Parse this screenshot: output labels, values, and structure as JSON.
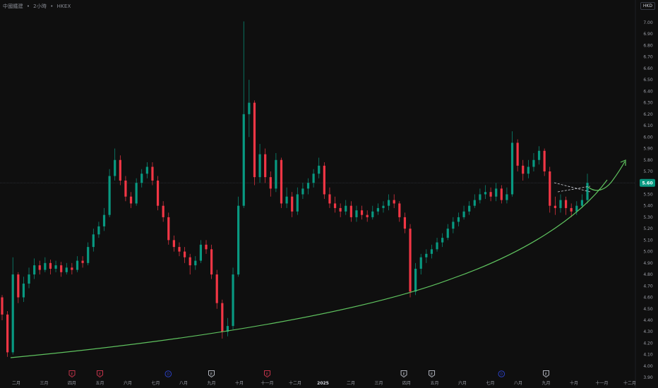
{
  "header": {
    "symbol": "中國鐵建",
    "interval": "2小時",
    "exchange": "HKEX",
    "currency": "HKD"
  },
  "colors": {
    "up": "#089981",
    "down": "#f23645",
    "trendline": "#5fc35f",
    "price_label": "#089981",
    "background": "#0f0f0f",
    "event_earnings": "#c2334a",
    "event_earnings_neutral": "#b2b5be",
    "event_dividend": "#2a3fbf"
  },
  "chart_data": {
    "type": "candlestick",
    "title": "",
    "ylim": [
      3.9,
      7.1
    ],
    "y_ticks": [
      "7.00",
      "6.90",
      "6.80",
      "6.70",
      "6.60",
      "6.50",
      "6.40",
      "6.30",
      "6.20",
      "6.10",
      "6.00",
      "5.90",
      "5.80",
      "5.70",
      "5.60",
      "5.50",
      "5.40",
      "5.30",
      "5.20",
      "5.10",
      "5.00",
      "4.90",
      "4.80",
      "4.70",
      "4.60",
      "4.50",
      "4.40",
      "4.30",
      "4.20",
      "4.10",
      "4.00",
      "3.90"
    ],
    "x_ticks": [
      "二月",
      "三月",
      "四月",
      "五月",
      "六月",
      "七月",
      "八月",
      "九月",
      "十月",
      "十一月",
      "十二月",
      "2025",
      "二月",
      "三月",
      "四月",
      "五月",
      "六月",
      "七月",
      "八月",
      "九月",
      "十月",
      "十一月",
      "十二月"
    ],
    "current_price": "5.60",
    "first_open": 4.6,
    "close": [
      4.45,
      4.12,
      4.8,
      4.6,
      4.72,
      4.8,
      4.88,
      4.84,
      4.9,
      4.85,
      4.88,
      4.82,
      4.86,
      4.84,
      4.92,
      4.9,
      5.04,
      5.15,
      5.22,
      5.32,
      5.66,
      5.8,
      5.62,
      5.48,
      5.42,
      5.6,
      5.68,
      5.74,
      5.62,
      5.4,
      5.3,
      5.1,
      5.04,
      5.0,
      4.95,
      4.88,
      4.92,
      5.06,
      5.02,
      4.8,
      4.55,
      4.3,
      4.35,
      4.8,
      5.4,
      6.2,
      6.3,
      5.65,
      5.85,
      5.65,
      5.55,
      5.8,
      5.42,
      5.48,
      5.35,
      5.5,
      5.55,
      5.6,
      5.68,
      5.75,
      5.5,
      5.42,
      5.38,
      5.35,
      5.4,
      5.3,
      5.36,
      5.32,
      5.3,
      5.35,
      5.38,
      5.4,
      5.45,
      5.42,
      5.3,
      5.2,
      4.65,
      4.85,
      4.95,
      4.98,
      5.02,
      5.08,
      5.12,
      5.2,
      5.26,
      5.3,
      5.35,
      5.4,
      5.45,
      5.5,
      5.52,
      5.48,
      5.55,
      5.45,
      5.5,
      5.95,
      5.75,
      5.68,
      5.74,
      5.8,
      5.88,
      5.7,
      5.4,
      5.38,
      5.45,
      5.38,
      5.35,
      5.4,
      5.45,
      5.6
    ],
    "high": [
      4.62,
      4.48,
      4.95,
      4.82,
      4.78,
      4.86,
      4.94,
      4.92,
      4.95,
      4.93,
      4.92,
      4.91,
      4.9,
      4.9,
      4.96,
      4.96,
      5.08,
      5.2,
      5.26,
      5.38,
      5.72,
      5.9,
      5.84,
      5.66,
      5.52,
      5.64,
      5.72,
      5.78,
      5.78,
      5.66,
      5.44,
      5.34,
      5.14,
      5.08,
      5.04,
      4.98,
      4.96,
      5.1,
      5.1,
      5.06,
      4.84,
      4.58,
      4.42,
      4.86,
      5.48,
      7.01,
      6.5,
      6.32,
      5.94,
      5.9,
      5.7,
      5.86,
      5.82,
      5.56,
      5.52,
      5.56,
      5.6,
      5.64,
      5.72,
      5.82,
      5.78,
      5.56,
      5.48,
      5.42,
      5.45,
      5.44,
      5.4,
      5.4,
      5.36,
      5.4,
      5.42,
      5.44,
      5.5,
      5.5,
      5.44,
      5.34,
      5.24,
      4.9,
      4.98,
      5.02,
      5.06,
      5.12,
      5.16,
      5.24,
      5.3,
      5.34,
      5.4,
      5.44,
      5.5,
      5.55,
      5.58,
      5.56,
      5.6,
      5.58,
      5.56,
      6.05,
      5.98,
      5.8,
      5.8,
      5.86,
      5.92,
      5.9,
      5.74,
      5.48,
      5.5,
      5.48,
      5.42,
      5.44,
      5.5,
      5.68
    ],
    "low": [
      4.4,
      4.08,
      4.1,
      4.55,
      4.56,
      4.68,
      4.76,
      4.8,
      4.82,
      4.8,
      4.82,
      4.78,
      4.8,
      4.8,
      4.82,
      4.86,
      4.88,
      5.0,
      5.12,
      5.18,
      5.3,
      5.62,
      5.58,
      5.44,
      5.38,
      5.4,
      5.56,
      5.64,
      5.58,
      5.36,
      5.26,
      5.06,
      5.0,
      4.96,
      4.9,
      4.8,
      4.84,
      4.9,
      4.98,
      4.76,
      4.5,
      4.24,
      4.26,
      4.32,
      4.78,
      5.38,
      6.0,
      5.58,
      5.6,
      5.6,
      5.48,
      5.52,
      5.38,
      5.38,
      5.3,
      5.32,
      5.46,
      5.5,
      5.56,
      5.64,
      5.46,
      5.38,
      5.34,
      5.3,
      5.32,
      5.26,
      5.26,
      5.28,
      5.26,
      5.28,
      5.32,
      5.34,
      5.36,
      5.38,
      5.26,
      5.16,
      4.6,
      4.62,
      4.8,
      4.9,
      4.94,
      5.0,
      5.04,
      5.1,
      5.16,
      5.22,
      5.28,
      5.32,
      5.38,
      5.42,
      5.46,
      5.44,
      5.44,
      5.42,
      5.42,
      5.48,
      5.7,
      5.62,
      5.64,
      5.7,
      5.76,
      5.66,
      5.34,
      5.32,
      5.34,
      5.32,
      5.3,
      5.32,
      5.38,
      5.42
    ],
    "events": [
      {
        "label": "E",
        "type": "earnings",
        "month_index": 2
      },
      {
        "label": "E",
        "type": "earnings",
        "month_index": 3
      },
      {
        "label": "D",
        "type": "dividend",
        "month_index": 5.45
      },
      {
        "label": "E",
        "type": "earnings_neutral",
        "month_index": 7
      },
      {
        "label": "E",
        "type": "earnings",
        "month_index": 9
      },
      {
        "label": "E",
        "type": "earnings_neutral",
        "month_index": 13.9
      },
      {
        "label": "E",
        "type": "earnings_neutral",
        "month_index": 14.9
      },
      {
        "label": "D",
        "type": "dividend",
        "month_index": 17.4
      },
      {
        "label": "E",
        "type": "earnings_neutral",
        "month_index": 19
      }
    ]
  }
}
